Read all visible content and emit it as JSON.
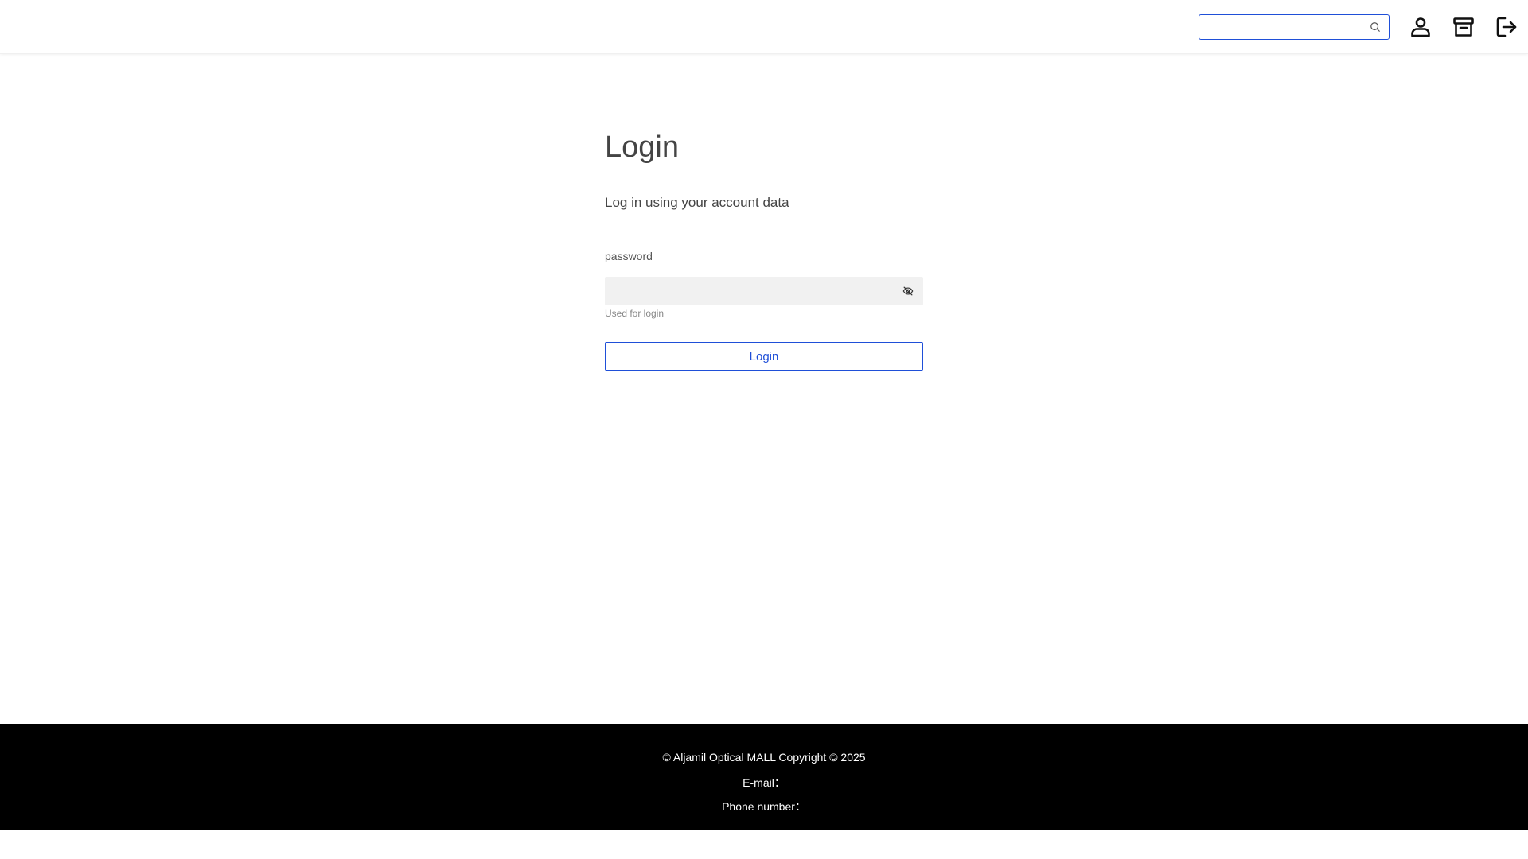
{
  "header": {
    "search": {
      "value": "",
      "placeholder": ""
    },
    "icons": [
      "search-icon",
      "user-icon",
      "archive-icon",
      "logout-icon"
    ],
    "accent_color": "#1f4fd8"
  },
  "login": {
    "title": "Login",
    "subtitle": "Log in using your account data",
    "password_label": "password",
    "password_value": "",
    "password_hint": "Used for login",
    "button_label": "Login"
  },
  "footer": {
    "copyright": "© Aljamil Optical MALL Copyright © 2025",
    "email": "E-mail：",
    "phone": "Phone number："
  }
}
